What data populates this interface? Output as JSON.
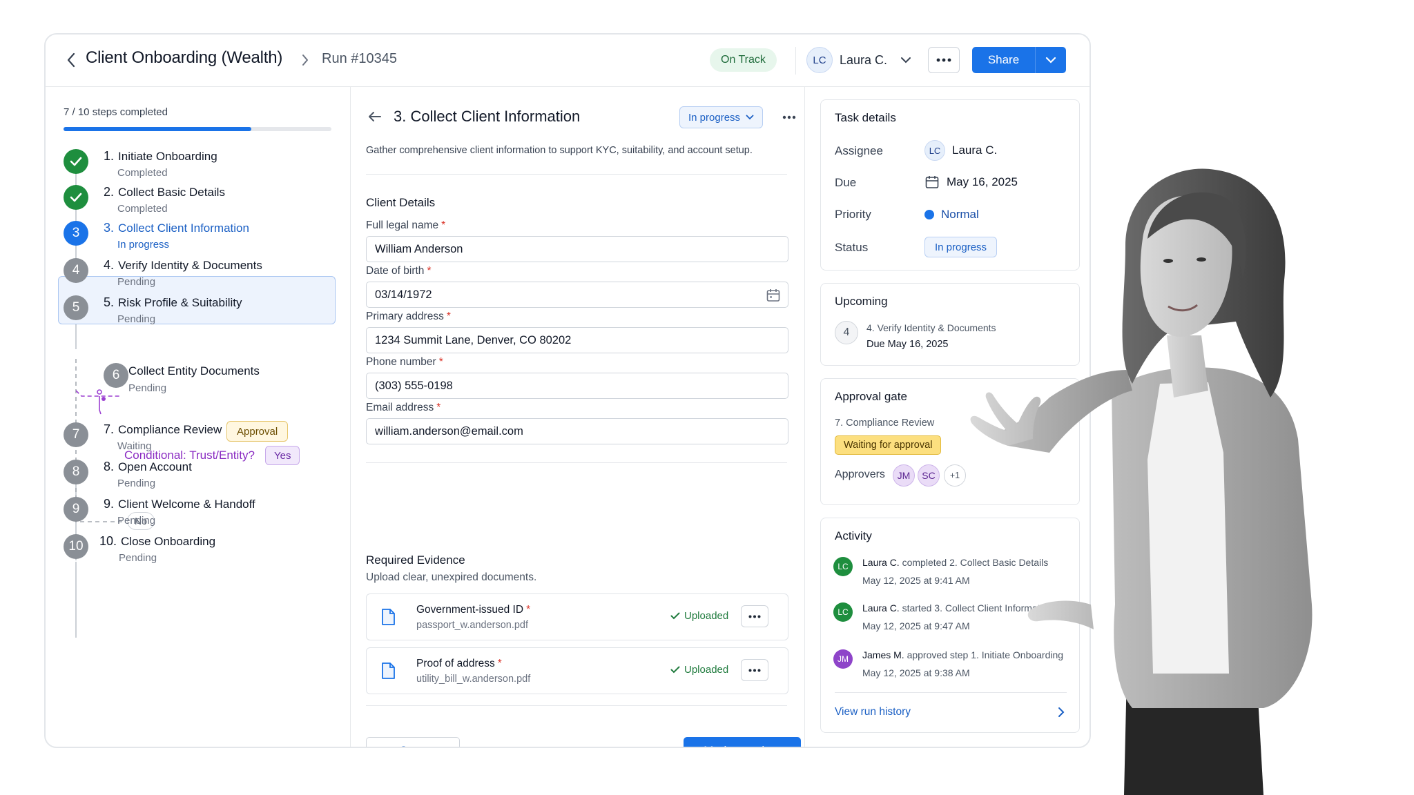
{
  "header": {
    "title": "Client Onboarding (Wealth)",
    "run": "Run #10345",
    "status": "On Track",
    "user_initials": "LC",
    "user_name": "Laura C.",
    "share_label": "Share"
  },
  "progress": {
    "label": "7 / 10 steps completed",
    "fraction": 0.7
  },
  "steps": [
    {
      "num": "1.",
      "circle": "✓",
      "title": "Initiate Onboarding",
      "status": "Completed"
    },
    {
      "num": "2.",
      "circle": "✓",
      "title": "Collect Basic Details",
      "status": "Completed"
    },
    {
      "num": "3.",
      "circle": "3",
      "title": "Collect Client Information",
      "status": "In progress"
    },
    {
      "num": "4.",
      "circle": "4",
      "title": "Verify Identity & Documents",
      "status": "Pending"
    },
    {
      "num": "5.",
      "circle": "5",
      "title": "Risk Profile & Suitability",
      "status": "Pending"
    },
    {
      "num": "",
      "circle": "6",
      "title": "Collect Entity Documents",
      "status": "Pending"
    },
    {
      "num": "7.",
      "circle": "7",
      "title": "Compliance Review",
      "status": "Waiting",
      "badge": "Approval"
    },
    {
      "num": "8.",
      "circle": "8",
      "title": "Open Account",
      "status": "Pending"
    },
    {
      "num": "9.",
      "circle": "9",
      "title": "Client Welcome & Handoff",
      "status": "Pending"
    },
    {
      "num": "10.",
      "circle": "10",
      "title": "Close Onboarding",
      "status": "Pending"
    }
  ],
  "conditional": {
    "label": "Conditional: Trust/Entity?",
    "yes": "Yes",
    "no": "No"
  },
  "task": {
    "title": "3. Collect Client Information",
    "status": "In progress",
    "description": "Gather comprehensive client information to support KYC, suitability, and account setup.",
    "section_title": "Client Details",
    "fields": [
      {
        "label": "Full legal name",
        "value": "William Anderson"
      },
      {
        "label": "Date of birth",
        "value": "03/14/1972"
      },
      {
        "label": "Primary address",
        "value": "1234 Summit Lane, Denver, CO 80202"
      },
      {
        "label": "Phone number",
        "value": "(303) 555-0198"
      },
      {
        "label": "Email address",
        "value": "william.anderson@email.com"
      }
    ],
    "required_mark": "*",
    "evidence_title": "Required Evidence",
    "evidence_sub": "Upload clear, unexpired documents.",
    "evidence": [
      {
        "name": "Government-issued ID",
        "file": "passport_w.anderson.pdf",
        "status": "Uploaded"
      },
      {
        "name": "Proof of address",
        "file": "utility_bill_w.anderson.pdf",
        "status": "Uploaded"
      }
    ],
    "save_label": "Save",
    "complete_label": "Mark complete"
  },
  "details": {
    "title": "Task details",
    "assignee_key": "Assignee",
    "assignee_initials": "LC",
    "assignee": "Laura C.",
    "due_key": "Due",
    "due": "May 16, 2025",
    "priority_key": "Priority",
    "priority": "Normal",
    "status_key": "Status",
    "status": "In progress"
  },
  "upcoming": {
    "title": "Upcoming",
    "num": "4",
    "step": "4. Verify Identity & Documents",
    "due": "Due May 16, 2025"
  },
  "approval": {
    "title": "Approval gate",
    "step": "7. Compliance Review",
    "badge": "Waiting for approval",
    "approvers_label": "Approvers",
    "approvers": [
      "JM",
      "SC"
    ],
    "more": "+1"
  },
  "activity": {
    "title": "Activity",
    "items": [
      {
        "initials": "LC",
        "who": "Laura C.",
        "text": "completed 2. Collect Basic Details",
        "time": "May 12, 2025 at 9:41 AM",
        "color": "#1e8e3e"
      },
      {
        "initials": "LC",
        "who": "Laura C.",
        "text": "started 3. Collect Client Information",
        "time": "May 12, 2025 at 9:47 AM",
        "color": "#1e8e3e"
      },
      {
        "initials": "JM",
        "who": "James M.",
        "text": "approved step 1. Initiate Onboarding",
        "time": "May 12, 2025 at 9:38 AM",
        "color": "#8e44c9"
      }
    ],
    "view_history": "View run history"
  },
  "icons": {
    "back": "chevron-left-icon",
    "breadcrumb": "chevron-right-icon",
    "calendar": "calendar-icon",
    "document": "document-icon",
    "check": "check-icon",
    "more": "more-horizontal-icon"
  },
  "colors": {
    "accent": "#1a73e8",
    "success": "#1e8e3e",
    "pending": "#8a8f96",
    "conditional": "#8a2bc2",
    "warning": "#fcdf7f"
  }
}
